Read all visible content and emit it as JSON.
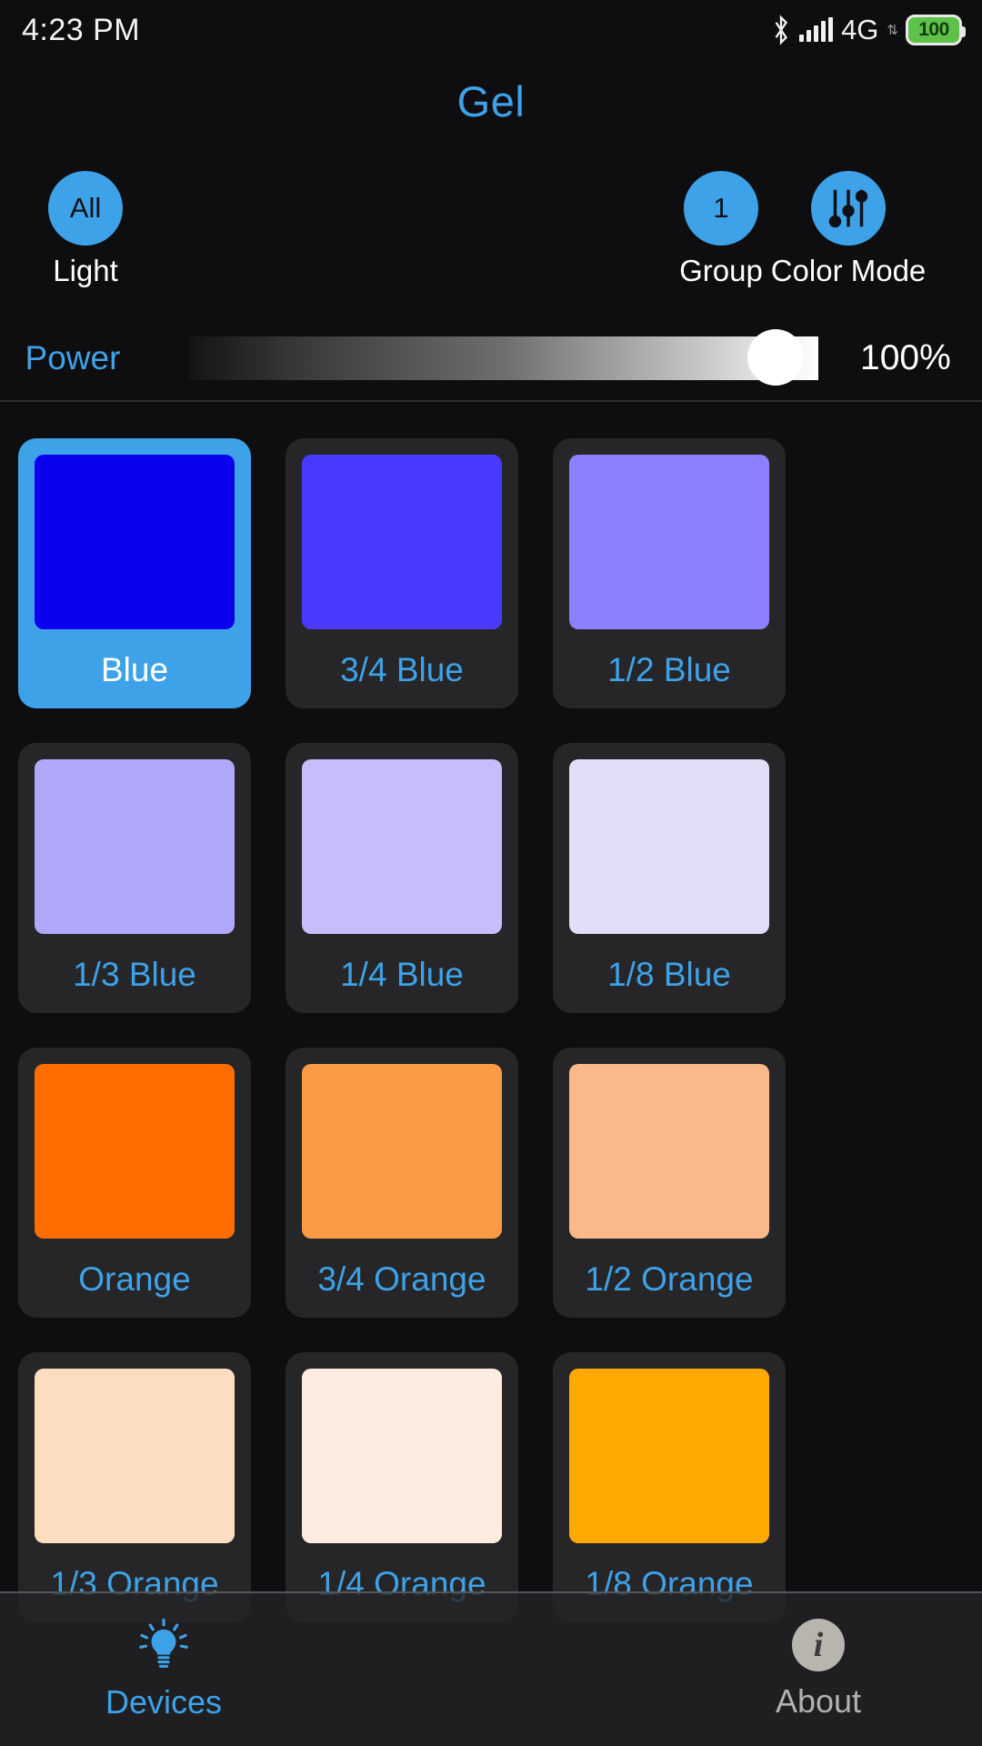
{
  "statusbar": {
    "time": "4:23 PM",
    "bluetooth_icon": "bluetooth-icon",
    "signal_icon": "signal-bars-icon",
    "network": "4G",
    "data_arrows": "⇅",
    "battery_level": "100"
  },
  "header": {
    "title": "Gel",
    "light_button": {
      "value": "All",
      "label": "Light"
    },
    "group_button": {
      "value": "1",
      "label": "Group"
    },
    "color_mode_button": {
      "label": "Color Mode",
      "icon": "sliders-icon"
    }
  },
  "power": {
    "label": "Power",
    "value": "100%",
    "percent": 100
  },
  "gels": [
    {
      "name": "Blue",
      "color": "#0a00ee",
      "selected": true
    },
    {
      "name": "3/4 Blue",
      "color": "#4a3aff",
      "selected": false
    },
    {
      "name": "1/2 Blue",
      "color": "#8b80ff",
      "selected": false
    },
    {
      "name": "1/3 Blue",
      "color": "#b0a9fb",
      "selected": false
    },
    {
      "name": "1/4 Blue",
      "color": "#c5befb",
      "selected": false
    },
    {
      "name": "1/8 Blue",
      "color": "#e1def8",
      "selected": false
    },
    {
      "name": "Orange",
      "color": "#ff6d00",
      "selected": false
    },
    {
      "name": "3/4 Orange",
      "color": "#fb9a45",
      "selected": false
    },
    {
      "name": "1/2 Orange",
      "color": "#fbb98a",
      "selected": false
    },
    {
      "name": "1/3 Orange",
      "color": "#fcddc0",
      "selected": false
    },
    {
      "name": "1/4 Orange",
      "color": "#fcece0",
      "selected": false
    },
    {
      "name": "1/8 Orange",
      "color": "#ffa800",
      "selected": false
    }
  ],
  "bottomnav": [
    {
      "label": "Devices",
      "icon": "lightbulb-icon",
      "active": true
    },
    {
      "label": "",
      "icon": "",
      "active": false
    },
    {
      "label": "About",
      "icon": "info-icon",
      "active": false
    }
  ],
  "colors": {
    "accent": "#3ea2e8",
    "background": "#0e0e11",
    "card": "#262628",
    "text": "#ffffff"
  }
}
